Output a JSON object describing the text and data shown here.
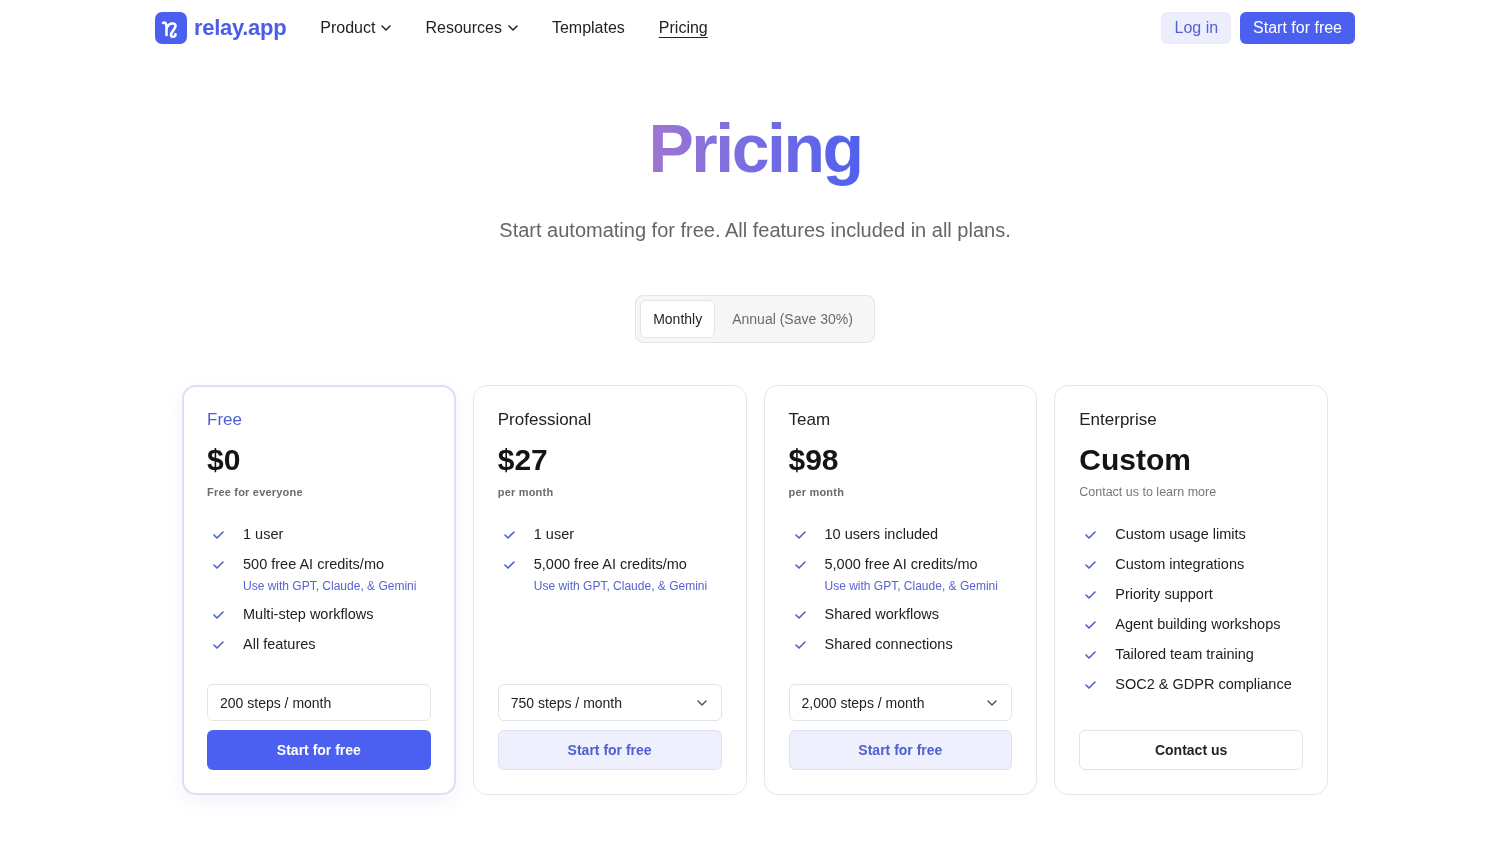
{
  "nav": {
    "logo": {
      "text": "relay.app"
    },
    "items": [
      {
        "label": "Product",
        "dropdown": true,
        "selected": false
      },
      {
        "label": "Resources",
        "dropdown": true,
        "selected": false
      },
      {
        "label": "Templates",
        "dropdown": false,
        "selected": false
      },
      {
        "label": "Pricing",
        "dropdown": false,
        "selected": true
      }
    ],
    "actions": [
      {
        "label": "Log in",
        "kind": "soft"
      },
      {
        "label": "Start for free",
        "kind": "primary"
      }
    ]
  },
  "hero": {
    "title": "Pricing",
    "subtitle": "Start automating for free. All features included in all plans."
  },
  "billing_toggle": {
    "options": [
      {
        "label": "Monthly",
        "selected": true
      },
      {
        "label": "Annual (Save 30%)",
        "selected": false
      }
    ]
  },
  "plans": [
    {
      "name": "Free",
      "featured": true,
      "price": "$0",
      "price_note": {
        "text": "Free for everyone",
        "kind": "caption"
      },
      "features": [
        {
          "text": "1 user"
        },
        {
          "text": "500 free AI credits/mo",
          "note": "Use with GPT, Claude, & Gemini"
        },
        {
          "text": "Multi-step workflows"
        },
        {
          "text": "All features"
        }
      ],
      "steps": {
        "value": "200 steps / month",
        "kind": "field"
      },
      "button": {
        "label": "Start for free",
        "kind": "primary"
      }
    },
    {
      "name": "Professional",
      "featured": false,
      "price": "$27",
      "price_note": {
        "text": "per month",
        "kind": "caption"
      },
      "features": [
        {
          "text": "1 user"
        },
        {
          "text": "5,000 free AI credits/mo",
          "note": "Use with GPT, Claude, & Gemini"
        }
      ],
      "steps": {
        "value": "750 steps / month",
        "kind": "dropdown"
      },
      "button": {
        "label": "Start for free",
        "kind": "soft"
      }
    },
    {
      "name": "Team",
      "featured": false,
      "price": "$98",
      "price_note": {
        "text": "per month",
        "kind": "caption"
      },
      "features": [
        {
          "text": "10 users included"
        },
        {
          "text": "5,000 free AI credits/mo",
          "note": "Use with GPT, Claude, & Gemini"
        },
        {
          "text": "Shared workflows"
        },
        {
          "text": "Shared connections"
        }
      ],
      "steps": {
        "value": "2,000 steps / month",
        "kind": "dropdown"
      },
      "button": {
        "label": "Start for free",
        "kind": "soft"
      }
    },
    {
      "name": "Enterprise",
      "featured": false,
      "price": "Custom",
      "price_note": {
        "text": "Contact us to learn more",
        "kind": "plain"
      },
      "features": [
        {
          "text": "Custom usage limits"
        },
        {
          "text": "Custom integrations"
        },
        {
          "text": "Priority support"
        },
        {
          "text": "Agent building workshops"
        },
        {
          "text": "Tailored team training"
        },
        {
          "text": "SOC2 & GDPR compliance"
        }
      ],
      "button": {
        "label": "Contact us",
        "kind": "outline"
      }
    }
  ]
}
